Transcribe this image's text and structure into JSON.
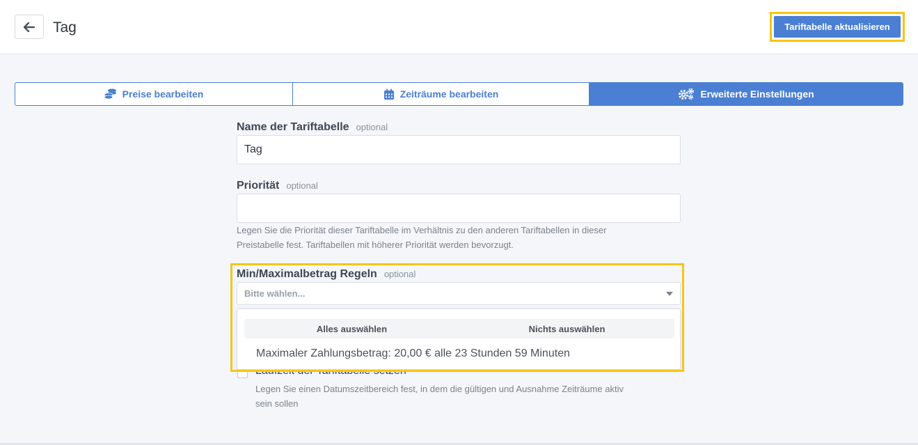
{
  "header": {
    "title": "Tag",
    "update_button": "Tariftabelle aktualisieren"
  },
  "tabs": [
    {
      "label": "Preise bearbeiten",
      "icon": "coins-icon",
      "active": false
    },
    {
      "label": "Zeiträume bearbeiten",
      "icon": "calendar-icon",
      "active": false
    },
    {
      "label": "Erweiterte Einstellungen",
      "icon": "gears-icon",
      "active": true
    }
  ],
  "form": {
    "name": {
      "label": "Name der Tariftabelle",
      "optional": "optional",
      "value": "Tag"
    },
    "priority": {
      "label": "Priorität",
      "optional": "optional",
      "value": "",
      "help_line1": "Legen Sie die Priorität dieser Tariftabelle im Verhältnis zu den anderen Tariftabellen in dieser",
      "help_line2": "Preistabelle fest. Tariftabellen mit höherer Priorität werden bevorzugt."
    },
    "minmax": {
      "label": "Min/Maximalbetrag Regeln",
      "optional": "optional",
      "placeholder": "Bitte wählen...",
      "select_all": "Alles auswählen",
      "select_none": "Nichts auswählen",
      "options": [
        "Maximaler Zahlungsbetrag: 20,00 € alle 23 Stunden 59 Minuten"
      ]
    },
    "runtime": {
      "label": "Laufzeit der Tariftabelle setzen",
      "checked": false,
      "help_line1": "Legen Sie einen Datumszeitbereich fest, in dem die gültigen und Ausnahme Zeiträume aktiv",
      "help_line2": "sein sollen"
    }
  },
  "colors": {
    "accent": "#4a7fd3",
    "highlight": "#f5c518",
    "background": "#f4f6f9"
  }
}
